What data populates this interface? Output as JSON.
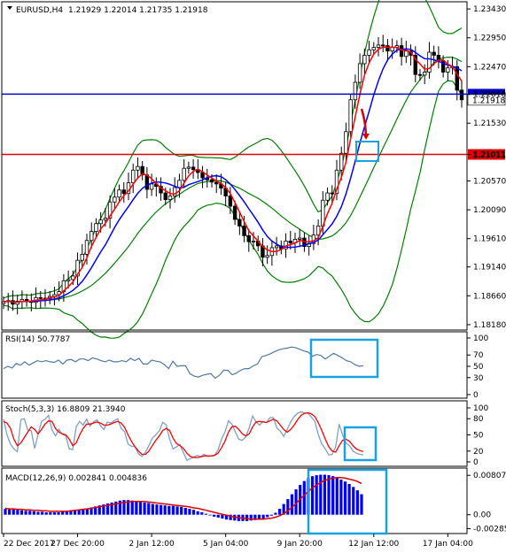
{
  "chart_data": [
    {
      "type": "candlestick",
      "symbol_label": "EURUSD,H4",
      "ohlc_text": "1.21929 1.22014 1.21735 1.21918",
      "y_ticks": [
        "1.23430",
        "1.22950",
        "1.22470",
        "1.22010",
        "1.21530",
        "1.21011",
        "1.20570",
        "1.20090",
        "1.19610",
        "1.19140",
        "1.18660",
        "1.18180"
      ],
      "y_tick_values": [
        1.2343,
        1.2295,
        1.2247,
        1.2201,
        1.2153,
        1.21011,
        1.2057,
        1.2009,
        1.1961,
        1.1914,
        1.1866,
        1.1818
      ],
      "ylim": [
        1.1812,
        1.2352
      ],
      "blue_level": {
        "label": "1.22013",
        "value": 1.22013,
        "color": "#0000cc"
      },
      "red_level": {
        "label": "1.21011",
        "value": 1.21011,
        "color": "#dd0000"
      },
      "current_price": {
        "label": "1.21918",
        "value": 1.21918
      },
      "x_labels": [
        "22 Dec 2017",
        "27 Dec 20:00",
        "2 Jan 12:00",
        "5 Jan 04:00",
        "9 Jan 20:00",
        "12 Jan 12:00",
        "17 Jan 04:00"
      ],
      "x_label_bars": [
        0,
        16,
        32,
        48,
        64,
        80,
        96
      ],
      "close_series": [
        1.1856,
        1.1858,
        1.1852,
        1.1857,
        1.186,
        1.1857,
        1.1855,
        1.1863,
        1.1862,
        1.1861,
        1.1865,
        1.1868,
        1.1873,
        1.1891,
        1.1893,
        1.1899,
        1.1925,
        1.1935,
        1.1958,
        1.1973,
        1.1986,
        1.1992,
        1.1995,
        1.2022,
        1.203,
        1.2042,
        1.2036,
        1.2054,
        1.2075,
        1.2081,
        1.2067,
        1.2043,
        1.2052,
        1.2048,
        1.2037,
        1.2026,
        1.2032,
        1.2046,
        1.2058,
        1.2078,
        1.208,
        1.2076,
        1.2071,
        1.2062,
        1.2059,
        1.2055,
        1.2052,
        1.2045,
        1.2032,
        1.2015,
        1.1993,
        1.1982,
        1.1966,
        1.1956,
        1.1957,
        1.1949,
        1.193,
        1.1933,
        1.1946,
        1.1949,
        1.1944,
        1.1957,
        1.1954,
        1.196,
        1.1962,
        1.1948,
        1.1953,
        1.1967,
        1.1982,
        1.2025,
        1.2037,
        1.2036,
        1.2075,
        1.2103,
        1.2139,
        1.2192,
        1.2221,
        1.2252,
        1.2266,
        1.2275,
        1.2279,
        1.2283,
        1.2282,
        1.2273,
        1.2279,
        1.2282,
        1.2264,
        1.2273,
        1.2266,
        1.2234,
        1.2233,
        1.2238,
        1.2271,
        1.2266,
        1.2257,
        1.2238,
        1.2245,
        1.2247,
        1.2208,
        1.2192
      ],
      "overlays": [
        {
          "name": "fast MA",
          "color": "#ff0000"
        },
        {
          "name": "slow MA",
          "color": "#0000ff"
        },
        {
          "name": "Bollinger Bands",
          "color": "#008000"
        }
      ],
      "annotations": [
        "red arrow pointing down",
        "blue box at 1.21011 level"
      ]
    },
    {
      "type": "line",
      "label": "RSI(14) 50.7787",
      "y_ticks": [
        "100",
        "70",
        "50",
        "30",
        "0"
      ],
      "y_tick_values": [
        100,
        70,
        50,
        30,
        0
      ],
      "ylim": [
        0,
        100
      ],
      "series": [
        {
          "color": "#4e79a7",
          "values": [
            46,
            50,
            47,
            55,
            52,
            58,
            52,
            56,
            60,
            58,
            60,
            58,
            57,
            61,
            54,
            61,
            62,
            58,
            63,
            63,
            60,
            65,
            63,
            60,
            58,
            61,
            58,
            58,
            60,
            58,
            64,
            60,
            64,
            54,
            54,
            61,
            59,
            58,
            53,
            46,
            59,
            50,
            51,
            51,
            37,
            33,
            31,
            34,
            36,
            37,
            29,
            34,
            43,
            43,
            35,
            38,
            43,
            46,
            46,
            51,
            54,
            67,
            69,
            72,
            76,
            79,
            81,
            82,
            84,
            83,
            80,
            77,
            75,
            68,
            71,
            69,
            63,
            68,
            73,
            69,
            65,
            60,
            58,
            53,
            50,
            51
          ]
        }
      ],
      "annotations": [
        "blue box over final segment"
      ]
    },
    {
      "type": "line",
      "label": "Stoch(5,3,3) 16.8809 21.3940",
      "y_ticks": [
        "100",
        "80",
        "50",
        "20",
        "0"
      ],
      "y_tick_values": [
        100,
        80,
        50,
        20,
        0
      ],
      "ylim": [
        0,
        100
      ],
      "series": [
        {
          "name": "Main",
          "color": "#7fa0c8",
          "values": [
            79,
            50,
            33,
            24,
            19,
            78,
            80,
            59,
            58,
            25,
            51,
            75,
            79,
            86,
            59,
            48,
            60,
            51,
            48,
            24,
            23,
            65,
            75,
            68,
            79,
            66,
            74,
            78,
            67,
            60,
            74,
            72,
            76,
            80,
            62,
            56,
            33,
            29,
            28,
            15,
            10,
            18,
            30,
            44,
            50,
            57,
            73,
            69,
            42,
            24,
            28,
            32,
            17,
            3,
            6,
            9,
            12,
            10,
            14,
            10,
            11,
            12,
            22,
            42,
            55,
            76,
            70,
            55,
            42,
            40,
            46,
            63,
            85,
            74,
            68,
            75,
            73,
            82,
            82,
            63,
            57,
            47,
            60,
            74,
            84,
            90,
            93,
            90,
            90,
            83,
            75,
            50,
            33,
            24,
            13,
            14,
            28,
            70,
            50,
            35,
            30,
            20,
            16,
            14,
            13
          ]
        },
        {
          "name": "Signal",
          "color": "#ff0000",
          "values": [
            75,
            72,
            62,
            42,
            30,
            35,
            45,
            55,
            65,
            60,
            52,
            60,
            70,
            76,
            75,
            62,
            55,
            52,
            50,
            42,
            30,
            35,
            50,
            62,
            70,
            70,
            72,
            74,
            72,
            68,
            68,
            70,
            73,
            75,
            72,
            64,
            50,
            38,
            28,
            20,
            14,
            14,
            20,
            30,
            40,
            48,
            58,
            62,
            58,
            44,
            34,
            30,
            25,
            16,
            10,
            8,
            8,
            9,
            11,
            11,
            11,
            12,
            16,
            26,
            38,
            55,
            65,
            66,
            60,
            52,
            48,
            52,
            65,
            74,
            75,
            74,
            73,
            76,
            79,
            76,
            68,
            60,
            55,
            60,
            68,
            78,
            86,
            90,
            91,
            89,
            84,
            72,
            58,
            42,
            28,
            20,
            18,
            30,
            40,
            42,
            38,
            30,
            24,
            21,
            19
          ]
        }
      ],
      "annotations": [
        "blue box over final segment"
      ]
    },
    {
      "type": "bar",
      "label": "MACD(12,26,9) 0.002841 0.004836",
      "y_ticks": [
        "0.008072",
        "0.00",
        "-0.002851"
      ],
      "y_tick_values": [
        0.008072,
        0,
        -0.002851
      ],
      "ylim": [
        -0.0035,
        0.0092
      ],
      "histogram": {
        "color": "#0000ff",
        "values": [
          0.0012,
          0.0011,
          0.0011,
          0.001,
          0.0009,
          0.0008,
          0.0008,
          0.0007,
          0.0006,
          0.0006,
          0.0005,
          0.0005,
          0.0005,
          0.0005,
          0.0006,
          0.0007,
          0.0008,
          0.0009,
          0.001,
          0.0012,
          0.0013,
          0.0015,
          0.0017,
          0.0019,
          0.0021,
          0.0023,
          0.0025,
          0.0027,
          0.0029,
          0.003,
          0.003,
          0.0029,
          0.0028,
          0.0027,
          0.0025,
          0.0024,
          0.0022,
          0.0021,
          0.002,
          0.0019,
          0.0018,
          0.0018,
          0.0017,
          0.0016,
          0.0014,
          0.0012,
          0.001,
          0.0007,
          0.0005,
          0.0002,
          -0.0001,
          -0.0004,
          -0.0006,
          -0.0008,
          -0.001,
          -0.0011,
          -0.0012,
          -0.0013,
          -0.0013,
          -0.0013,
          -0.0012,
          -0.0011,
          -0.001,
          -0.0008,
          -0.0005,
          -0.0002,
          0.0004,
          0.0012,
          0.0022,
          0.0032,
          0.0042,
          0.0052,
          0.0061,
          0.0069,
          0.0075,
          0.0079,
          0.0081,
          0.0082,
          0.0082,
          0.0081,
          0.0079,
          0.0076,
          0.0072,
          0.0068,
          0.0063,
          0.0057,
          0.005,
          0.0042
        ]
      },
      "signal": {
        "color": "#dd0000",
        "values": [
          0.0013,
          0.0012,
          0.0012,
          0.0011,
          0.0011,
          0.001,
          0.001,
          0.0009,
          0.0009,
          0.0008,
          0.0008,
          0.0007,
          0.0007,
          0.0007,
          0.0007,
          0.0007,
          0.0008,
          0.0009,
          0.001,
          0.0011,
          0.0012,
          0.0013,
          0.0015,
          0.0016,
          0.0018,
          0.0019,
          0.0021,
          0.0022,
          0.0024,
          0.0025,
          0.0026,
          0.0027,
          0.0027,
          0.0027,
          0.0027,
          0.0026,
          0.0025,
          0.0024,
          0.0023,
          0.0022,
          0.0021,
          0.002,
          0.0019,
          0.0018,
          0.0017,
          0.0016,
          0.0014,
          0.0013,
          0.0011,
          0.0009,
          0.0007,
          0.0005,
          0.0003,
          0.0001,
          -0.0001,
          -0.0003,
          -0.0005,
          -0.0006,
          -0.0007,
          -0.0008,
          -0.0009,
          -0.0009,
          -0.0009,
          -0.0009,
          -0.0008,
          -0.0007,
          -0.0005,
          -0.0002,
          0.0002,
          0.0008,
          0.0015,
          0.0023,
          0.0032,
          0.004,
          0.0048,
          0.0055,
          0.0061,
          0.0066,
          0.007,
          0.0073,
          0.0075,
          0.0076,
          0.0076,
          0.0075,
          0.0073,
          0.0071,
          0.0068,
          0.0064
        ]
      },
      "annotations": [
        "blue box over final segment"
      ]
    }
  ]
}
